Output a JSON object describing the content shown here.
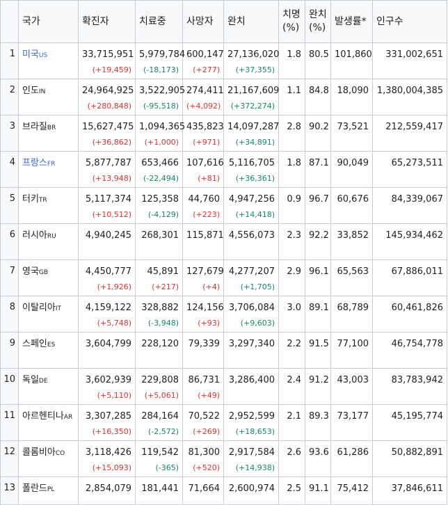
{
  "headers": {
    "country": "국가",
    "confirmed": "확진자",
    "treating": "치료중",
    "deaths": "사망자",
    "recovered": "완치",
    "fatality": "치명 (%)",
    "recovery": "완치 (%)",
    "incidence": "발생률*",
    "population": "인구수"
  },
  "rows": [
    {
      "rank": "1",
      "name": "미국",
      "code": "US",
      "link": true,
      "confirmed": "33,715,951",
      "confirmed_d": "(+19,459)",
      "treating": "5,979,784",
      "treating_d": "(-18,173)",
      "deaths": "600,147",
      "deaths_d": "(+277)",
      "recovered": "27,136,020",
      "recovered_d": "(+37,355)",
      "fatality": "1.8",
      "recovery": "80.5",
      "incidence": "101,860",
      "population": "331,002,651"
    },
    {
      "rank": "2",
      "name": "인도",
      "code": "IN",
      "link": false,
      "confirmed": "24,964,925",
      "confirmed_d": "(+280,848)",
      "treating": "3,522,905",
      "treating_d": "(-95,518)",
      "deaths": "274,411",
      "deaths_d": "(+4,092)",
      "recovered": "21,167,609",
      "recovered_d": "(+372,274)",
      "fatality": "1.1",
      "recovery": "84.8",
      "incidence": "18,090",
      "population": "1,380,004,385"
    },
    {
      "rank": "3",
      "name": "브라질",
      "code": "BR",
      "link": false,
      "confirmed": "15,627,475",
      "confirmed_d": "(+36,862)",
      "treating": "1,094,365",
      "treating_d": "(+1,000)",
      "deaths": "435,823",
      "deaths_d": "(+971)",
      "recovered": "14,097,287",
      "recovered_d": "(+34,891)",
      "fatality": "2.8",
      "recovery": "90.2",
      "incidence": "73,521",
      "population": "212,559,417"
    },
    {
      "rank": "4",
      "name": "프랑스",
      "code": "FR",
      "link": true,
      "confirmed": "5,877,787",
      "confirmed_d": "(+13,948)",
      "treating": "653,466",
      "treating_d": "(-22,494)",
      "deaths": "107,616",
      "deaths_d": "(+81)",
      "recovered": "5,116,705",
      "recovered_d": "(+36,361)",
      "fatality": "1.8",
      "recovery": "87.1",
      "incidence": "90,049",
      "population": "65,273,511"
    },
    {
      "rank": "5",
      "name": "터키",
      "code": "TR",
      "link": false,
      "confirmed": "5,117,374",
      "confirmed_d": "(+10,512)",
      "treating": "125,358",
      "treating_d": "(-4,129)",
      "deaths": "44,760",
      "deaths_d": "(+223)",
      "recovered": "4,947,256",
      "recovered_d": "(+14,418)",
      "fatality": "0.9",
      "recovery": "96.7",
      "incidence": "60,676",
      "population": "84,339,067"
    },
    {
      "rank": "6",
      "name": "러시아",
      "code": "RU",
      "link": false,
      "confirmed": "4,940,245",
      "confirmed_d": "",
      "treating": "268,301",
      "treating_d": "",
      "deaths": "115,871",
      "deaths_d": "",
      "recovered": "4,556,073",
      "recovered_d": "",
      "fatality": "2.3",
      "recovery": "92.2",
      "incidence": "33,852",
      "population": "145,934,462"
    },
    {
      "rank": "7",
      "name": "영국",
      "code": "GB",
      "link": false,
      "confirmed": "4,450,777",
      "confirmed_d": "(+1,926)",
      "treating": "45,891",
      "treating_d": "(+217)",
      "deaths": "127,679",
      "deaths_d": "(+4)",
      "recovered": "4,277,207",
      "recovered_d": "(+1,705)",
      "fatality": "2.9",
      "recovery": "96.1",
      "incidence": "65,563",
      "population": "67,886,011"
    },
    {
      "rank": "8",
      "name": "이탈리아",
      "code": "IT",
      "link": false,
      "confirmed": "4,159,122",
      "confirmed_d": "(+5,748)",
      "treating": "328,882",
      "treating_d": "(-3,948)",
      "deaths": "124,156",
      "deaths_d": "(+93)",
      "recovered": "3,706,084",
      "recovered_d": "(+9,603)",
      "fatality": "3.0",
      "recovery": "89.1",
      "incidence": "68,789",
      "population": "60,461,826"
    },
    {
      "rank": "9",
      "name": "스페인",
      "code": "ES",
      "link": false,
      "confirmed": "3,604,799",
      "confirmed_d": "",
      "treating": "228,120",
      "treating_d": "",
      "deaths": "79,339",
      "deaths_d": "",
      "recovered": "3,297,340",
      "recovered_d": "",
      "fatality": "2.2",
      "recovery": "91.5",
      "incidence": "77,100",
      "population": "46,754,778"
    },
    {
      "rank": "10",
      "name": "독일",
      "code": "DE",
      "link": false,
      "confirmed": "3,602,939",
      "confirmed_d": "(+5,110)",
      "treating": "229,808",
      "treating_d": "(+5,061)",
      "deaths": "86,731",
      "deaths_d": "(+49)",
      "recovered": "3,286,400",
      "recovered_d": "",
      "fatality": "2.4",
      "recovery": "91.2",
      "incidence": "43,003",
      "population": "83,783,942"
    },
    {
      "rank": "11",
      "name": "아르헨티나",
      "code": "AR",
      "link": false,
      "confirmed": "3,307,285",
      "confirmed_d": "(+16,350)",
      "treating": "284,164",
      "treating_d": "(-2,572)",
      "deaths": "70,522",
      "deaths_d": "(+269)",
      "recovered": "2,952,599",
      "recovered_d": "(+18,653)",
      "fatality": "2.1",
      "recovery": "89.3",
      "incidence": "73,177",
      "population": "45,195,774"
    },
    {
      "rank": "12",
      "name": "콜롬비아",
      "code": "CO",
      "link": false,
      "confirmed": "3,118,426",
      "confirmed_d": "(+15,093)",
      "treating": "119,542",
      "treating_d": "(-365)",
      "deaths": "81,300",
      "deaths_d": "(+520)",
      "recovered": "2,917,584",
      "recovered_d": "(+14,938)",
      "fatality": "2.6",
      "recovery": "93.6",
      "incidence": "61,286",
      "population": "50,882,891"
    },
    {
      "rank": "13",
      "name": "폴란드",
      "code": "PL",
      "link": false,
      "confirmed": "2,854,079",
      "confirmed_d": "",
      "treating": "181,441",
      "treating_d": "",
      "deaths": "71,664",
      "deaths_d": "",
      "recovered": "2,600,974",
      "recovered_d": "",
      "fatality": "2.5",
      "recovery": "91.1",
      "incidence": "75,412",
      "population": "37,846,611"
    }
  ],
  "colors": {
    "increase": "#d33",
    "decrease": "#14866d",
    "link": "#3366cc",
    "border": "#c8ccd1",
    "header_bg": "#f8f9fa"
  }
}
